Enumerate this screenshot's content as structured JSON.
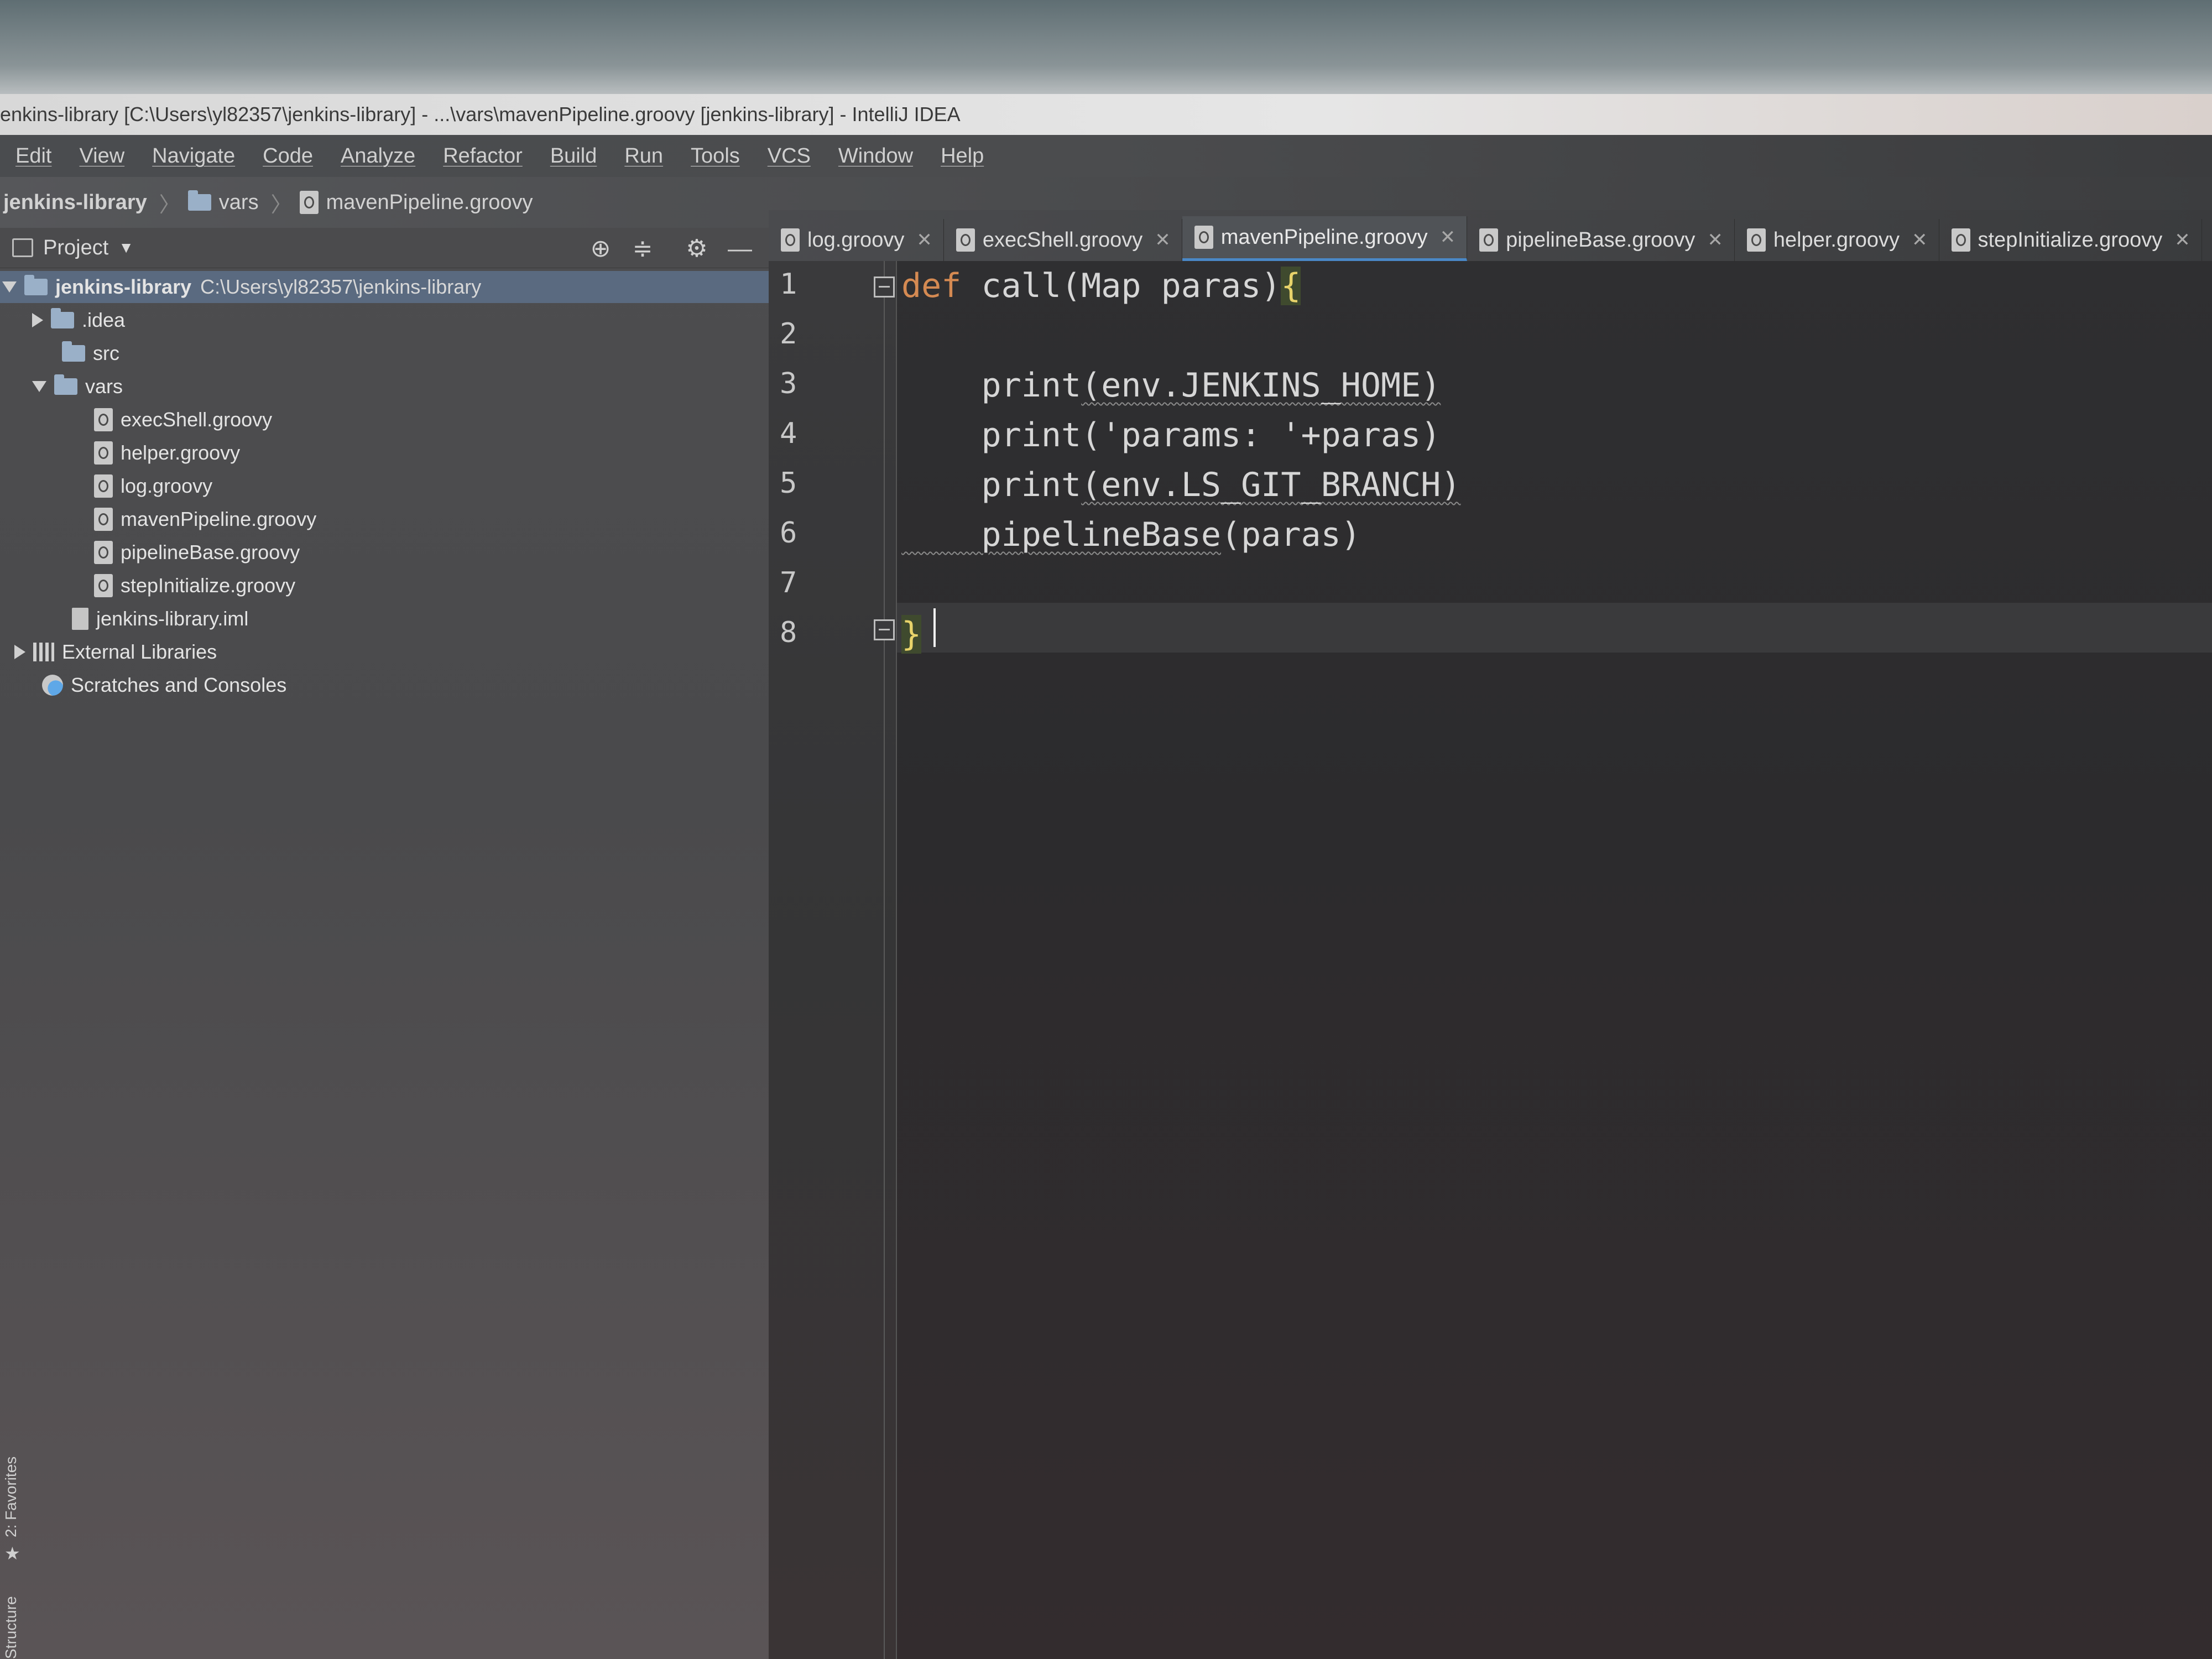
{
  "window": {
    "title": "enkins-library [C:\\Users\\yl82357\\jenkins-library] - ...\\vars\\mavenPipeline.groovy [jenkins-library] - IntelliJ IDEA"
  },
  "menu": [
    "Edit",
    "View",
    "Navigate",
    "Code",
    "Analyze",
    "Refactor",
    "Build",
    "Run",
    "Tools",
    "VCS",
    "Window",
    "Help"
  ],
  "breadcrumb": {
    "project": "jenkins-library",
    "folder": "vars",
    "file": "mavenPipeline.groovy"
  },
  "project_panel": {
    "title": "Project",
    "root": {
      "name": "jenkins-library",
      "path": "C:\\Users\\yl82357\\jenkins-library"
    },
    "folders": {
      "idea": ".idea",
      "src": "src",
      "vars": "vars"
    },
    "files": [
      "execShell.groovy",
      "helper.groovy",
      "log.groovy",
      "mavenPipeline.groovy",
      "pipelineBase.groovy",
      "stepInitialize.groovy"
    ],
    "iml": "jenkins-library.iml",
    "external_libraries": "External Libraries",
    "scratches": "Scratches and Consoles"
  },
  "side_tools": {
    "favorites": "2: Favorites",
    "structure": "Structure"
  },
  "tabs": [
    {
      "label": "log.groovy",
      "active": false
    },
    {
      "label": "execShell.groovy",
      "active": false
    },
    {
      "label": "mavenPipeline.groovy",
      "active": true
    },
    {
      "label": "pipelineBase.groovy",
      "active": false
    },
    {
      "label": "helper.groovy",
      "active": false
    },
    {
      "label": "stepInitialize.groovy",
      "active": false
    }
  ],
  "editor": {
    "line_numbers": [
      "1",
      "2",
      "3",
      "4",
      "5",
      "6",
      "7",
      "8"
    ],
    "code": {
      "l1_kw": "def",
      "l1_rest": " call(Map paras)",
      "l1_brace": "{",
      "l3_fn": "    print",
      "l3_arg": "(env.JENKINS_HOME)",
      "l4": "    print('params: '+paras)",
      "l5_fn": "    print",
      "l5_arg": "(env.LS_GIT_BRANCH)",
      "l6_fn": "    pipelineBase",
      "l6_arg": "(paras)",
      "l8_brace": "}"
    }
  },
  "colors": {
    "accent": "#4a88c7",
    "keyword": "#d58a52",
    "brace": "#e8d36a"
  }
}
